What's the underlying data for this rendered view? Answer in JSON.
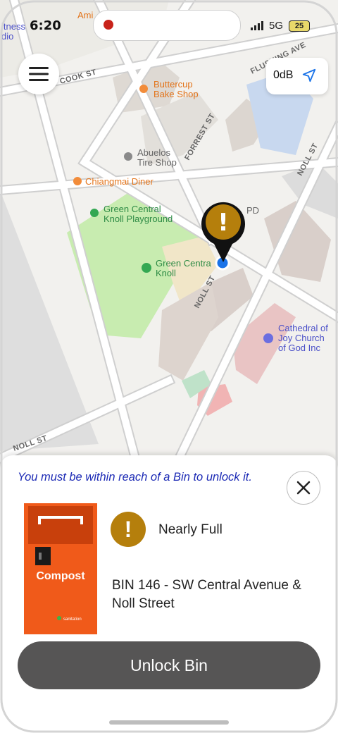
{
  "status_bar": {
    "time": "6:20",
    "network": "5G",
    "battery": "25"
  },
  "map": {
    "streets": [
      "COOK ST",
      "FLUSHING AVE",
      "FORREST ST",
      "NOLL ST",
      "NOLL ST",
      "NOLL ST"
    ],
    "places": [
      {
        "name": "Buttercup Bake Shop",
        "lines": [
          "Buttercup",
          "Bake Shop"
        ]
      },
      {
        "name": "Abuelos Tire Shop",
        "lines": [
          "Abuelos",
          "Tire Shop"
        ]
      },
      {
        "name": "Chiangmai Diner",
        "lines": [
          "Chiangmai Diner"
        ]
      },
      {
        "name": "Green Central Knoll Playground",
        "lines": [
          "Green Central",
          "Knoll Playground"
        ]
      },
      {
        "name": "Green Central Knoll",
        "lines": [
          "Green Centra",
          "Knoll"
        ]
      },
      {
        "name": "Cathedral of Joy Church of God Inc",
        "lines": [
          "Cathedral of",
          "Joy Church",
          "of God Inc"
        ]
      },
      {
        "name": "Ami",
        "lines": [
          "Ami"
        ]
      },
      {
        "name": "Fitness Studio",
        "lines": [
          "itness",
          "dio"
        ]
      },
      {
        "name": "PD",
        "lines": [
          "PD"
        ]
      }
    ]
  },
  "controls": {
    "sound_level": "0dB"
  },
  "pin": {
    "status_symbol": "!"
  },
  "sheet": {
    "message": "You must be within reach of a Bin to unlock it.",
    "bin_label": "Compost",
    "bin_brand": "sanitation",
    "status_symbol": "!",
    "status": "Nearly Full",
    "bin_name": "BIN 146 - SW Central Avenue & Noll Street",
    "unlock_label": "Unlock Bin"
  },
  "colors": {
    "warning": "#b57f0c",
    "message": "#1c2ab5",
    "button": "#565555",
    "bin": "#f05a1a",
    "park": "#c8ecb0"
  }
}
